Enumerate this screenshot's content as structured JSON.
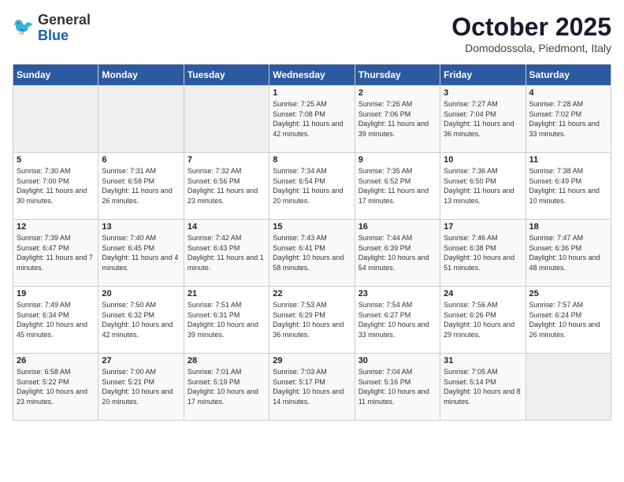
{
  "header": {
    "logo_general": "General",
    "logo_blue": "Blue",
    "month_title": "October 2025",
    "subtitle": "Domodossola, Piedmont, Italy"
  },
  "days_of_week": [
    "Sunday",
    "Monday",
    "Tuesday",
    "Wednesday",
    "Thursday",
    "Friday",
    "Saturday"
  ],
  "weeks": [
    [
      {
        "day": "",
        "sunrise": "",
        "sunset": "",
        "daylight": "",
        "empty": true
      },
      {
        "day": "",
        "sunrise": "",
        "sunset": "",
        "daylight": "",
        "empty": true
      },
      {
        "day": "",
        "sunrise": "",
        "sunset": "",
        "daylight": "",
        "empty": true
      },
      {
        "day": "1",
        "sunrise": "Sunrise: 7:25 AM",
        "sunset": "Sunset: 7:08 PM",
        "daylight": "Daylight: 11 hours and 42 minutes.",
        "empty": false
      },
      {
        "day": "2",
        "sunrise": "Sunrise: 7:26 AM",
        "sunset": "Sunset: 7:06 PM",
        "daylight": "Daylight: 11 hours and 39 minutes.",
        "empty": false
      },
      {
        "day": "3",
        "sunrise": "Sunrise: 7:27 AM",
        "sunset": "Sunset: 7:04 PM",
        "daylight": "Daylight: 11 hours and 36 minutes.",
        "empty": false
      },
      {
        "day": "4",
        "sunrise": "Sunrise: 7:28 AM",
        "sunset": "Sunset: 7:02 PM",
        "daylight": "Daylight: 11 hours and 33 minutes.",
        "empty": false
      }
    ],
    [
      {
        "day": "5",
        "sunrise": "Sunrise: 7:30 AM",
        "sunset": "Sunset: 7:00 PM",
        "daylight": "Daylight: 11 hours and 30 minutes.",
        "empty": false
      },
      {
        "day": "6",
        "sunrise": "Sunrise: 7:31 AM",
        "sunset": "Sunset: 6:58 PM",
        "daylight": "Daylight: 11 hours and 26 minutes.",
        "empty": false
      },
      {
        "day": "7",
        "sunrise": "Sunrise: 7:32 AM",
        "sunset": "Sunset: 6:56 PM",
        "daylight": "Daylight: 11 hours and 23 minutes.",
        "empty": false
      },
      {
        "day": "8",
        "sunrise": "Sunrise: 7:34 AM",
        "sunset": "Sunset: 6:54 PM",
        "daylight": "Daylight: 11 hours and 20 minutes.",
        "empty": false
      },
      {
        "day": "9",
        "sunrise": "Sunrise: 7:35 AM",
        "sunset": "Sunset: 6:52 PM",
        "daylight": "Daylight: 11 hours and 17 minutes.",
        "empty": false
      },
      {
        "day": "10",
        "sunrise": "Sunrise: 7:36 AM",
        "sunset": "Sunset: 6:50 PM",
        "daylight": "Daylight: 11 hours and 13 minutes.",
        "empty": false
      },
      {
        "day": "11",
        "sunrise": "Sunrise: 7:38 AM",
        "sunset": "Sunset: 6:49 PM",
        "daylight": "Daylight: 11 hours and 10 minutes.",
        "empty": false
      }
    ],
    [
      {
        "day": "12",
        "sunrise": "Sunrise: 7:39 AM",
        "sunset": "Sunset: 6:47 PM",
        "daylight": "Daylight: 11 hours and 7 minutes.",
        "empty": false
      },
      {
        "day": "13",
        "sunrise": "Sunrise: 7:40 AM",
        "sunset": "Sunset: 6:45 PM",
        "daylight": "Daylight: 11 hours and 4 minutes.",
        "empty": false
      },
      {
        "day": "14",
        "sunrise": "Sunrise: 7:42 AM",
        "sunset": "Sunset: 6:43 PM",
        "daylight": "Daylight: 11 hours and 1 minute.",
        "empty": false
      },
      {
        "day": "15",
        "sunrise": "Sunrise: 7:43 AM",
        "sunset": "Sunset: 6:41 PM",
        "daylight": "Daylight: 10 hours and 58 minutes.",
        "empty": false
      },
      {
        "day": "16",
        "sunrise": "Sunrise: 7:44 AM",
        "sunset": "Sunset: 6:39 PM",
        "daylight": "Daylight: 10 hours and 54 minutes.",
        "empty": false
      },
      {
        "day": "17",
        "sunrise": "Sunrise: 7:46 AM",
        "sunset": "Sunset: 6:38 PM",
        "daylight": "Daylight: 10 hours and 51 minutes.",
        "empty": false
      },
      {
        "day": "18",
        "sunrise": "Sunrise: 7:47 AM",
        "sunset": "Sunset: 6:36 PM",
        "daylight": "Daylight: 10 hours and 48 minutes.",
        "empty": false
      }
    ],
    [
      {
        "day": "19",
        "sunrise": "Sunrise: 7:49 AM",
        "sunset": "Sunset: 6:34 PM",
        "daylight": "Daylight: 10 hours and 45 minutes.",
        "empty": false
      },
      {
        "day": "20",
        "sunrise": "Sunrise: 7:50 AM",
        "sunset": "Sunset: 6:32 PM",
        "daylight": "Daylight: 10 hours and 42 minutes.",
        "empty": false
      },
      {
        "day": "21",
        "sunrise": "Sunrise: 7:51 AM",
        "sunset": "Sunset: 6:31 PM",
        "daylight": "Daylight: 10 hours and 39 minutes.",
        "empty": false
      },
      {
        "day": "22",
        "sunrise": "Sunrise: 7:53 AM",
        "sunset": "Sunset: 6:29 PM",
        "daylight": "Daylight: 10 hours and 36 minutes.",
        "empty": false
      },
      {
        "day": "23",
        "sunrise": "Sunrise: 7:54 AM",
        "sunset": "Sunset: 6:27 PM",
        "daylight": "Daylight: 10 hours and 33 minutes.",
        "empty": false
      },
      {
        "day": "24",
        "sunrise": "Sunrise: 7:56 AM",
        "sunset": "Sunset: 6:26 PM",
        "daylight": "Daylight: 10 hours and 29 minutes.",
        "empty": false
      },
      {
        "day": "25",
        "sunrise": "Sunrise: 7:57 AM",
        "sunset": "Sunset: 6:24 PM",
        "daylight": "Daylight: 10 hours and 26 minutes.",
        "empty": false
      }
    ],
    [
      {
        "day": "26",
        "sunrise": "Sunrise: 6:58 AM",
        "sunset": "Sunset: 5:22 PM",
        "daylight": "Daylight: 10 hours and 23 minutes.",
        "empty": false
      },
      {
        "day": "27",
        "sunrise": "Sunrise: 7:00 AM",
        "sunset": "Sunset: 5:21 PM",
        "daylight": "Daylight: 10 hours and 20 minutes.",
        "empty": false
      },
      {
        "day": "28",
        "sunrise": "Sunrise: 7:01 AM",
        "sunset": "Sunset: 5:19 PM",
        "daylight": "Daylight: 10 hours and 17 minutes.",
        "empty": false
      },
      {
        "day": "29",
        "sunrise": "Sunrise: 7:03 AM",
        "sunset": "Sunset: 5:17 PM",
        "daylight": "Daylight: 10 hours and 14 minutes.",
        "empty": false
      },
      {
        "day": "30",
        "sunrise": "Sunrise: 7:04 AM",
        "sunset": "Sunset: 5:16 PM",
        "daylight": "Daylight: 10 hours and 11 minutes.",
        "empty": false
      },
      {
        "day": "31",
        "sunrise": "Sunrise: 7:05 AM",
        "sunset": "Sunset: 5:14 PM",
        "daylight": "Daylight: 10 hours and 8 minutes.",
        "empty": false
      },
      {
        "day": "",
        "sunrise": "",
        "sunset": "",
        "daylight": "",
        "empty": true
      }
    ]
  ]
}
